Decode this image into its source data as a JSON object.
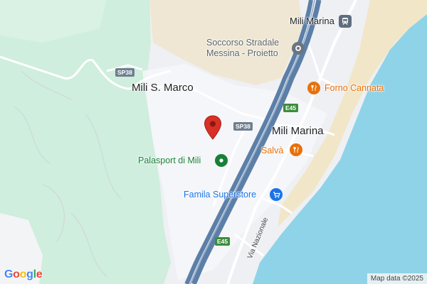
{
  "map": {
    "places": {
      "mili_marina_station": "Mili Marina",
      "soccorso_line1": "Soccorso Stradale",
      "soccorso_line2": "Messina - Proietto",
      "forno": "Forno Cannata",
      "mili_s_marco": "Mili S. Marco",
      "mili_marina_town": "Mili Marina",
      "salva": "Salvà",
      "palasport": "Palasport di Mili",
      "famila": "Famila Superstore",
      "via_nazionale": "Via Nazionale"
    },
    "road_shields": {
      "sp38_left": "SP38",
      "sp38_center": "SP38",
      "e45_top": "E45",
      "e45_bottom": "E45"
    },
    "attribution": "Map data ©2025",
    "logo": {
      "letters": [
        "G",
        "o",
        "o",
        "g",
        "l",
        "e"
      ]
    },
    "icons": {
      "marker": "red-location-pin-icon",
      "station": "train-station-icon",
      "service": "service-place-icon",
      "restaurant": "fork-knife-icon",
      "park": "park-icon",
      "shopping": "shopping-cart-icon"
    },
    "colors": {
      "sea": "#8fd3e8",
      "beach": "#f2e6c9",
      "forest": "#cfeedd",
      "land": "#eef0f3",
      "highway": "#5c7fa8",
      "marker": "#d93025",
      "food": "#e8710a",
      "shop": "#1a73e8",
      "park": "#188038",
      "service": "#5f6368",
      "logo_blue": "#4285F4",
      "logo_red": "#EA4335",
      "logo_yellow": "#FBBC05",
      "logo_green": "#34A853"
    }
  }
}
